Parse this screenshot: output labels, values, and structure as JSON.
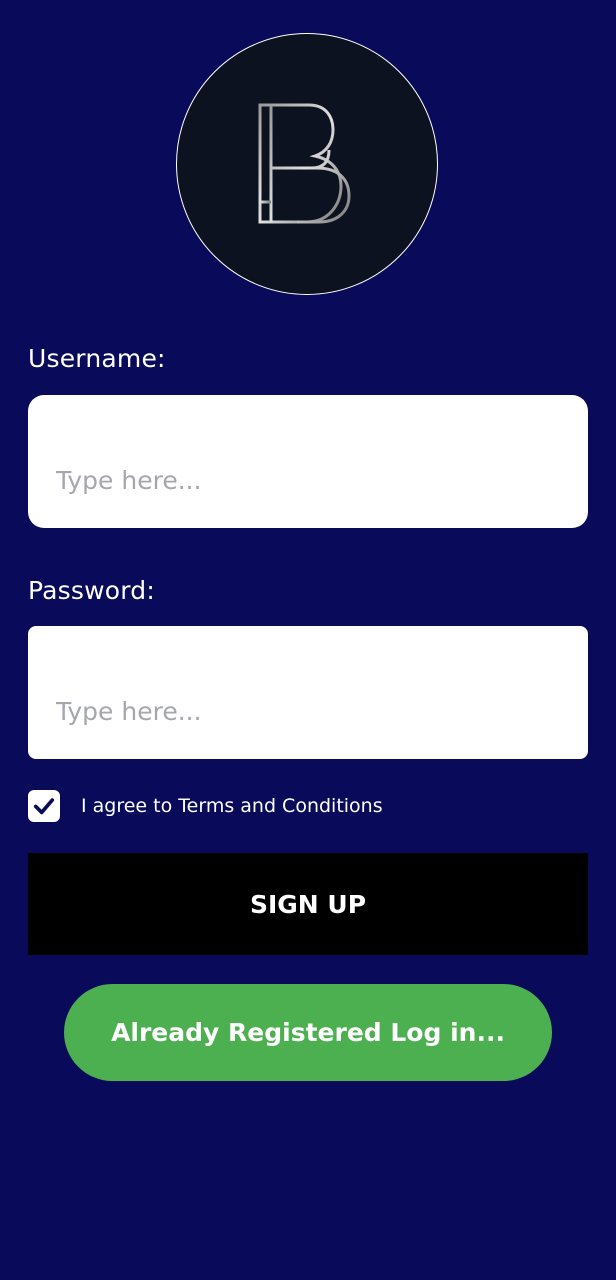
{
  "logo": {
    "icon": "bb-monogram-icon"
  },
  "form": {
    "username_label": "Username:",
    "username_placeholder": "Type here...",
    "username_value": "",
    "password_label": "Password:",
    "password_placeholder": "Type here...",
    "password_value": "",
    "agree_text": "I agree to Terms and Conditions",
    "agree_checked": true
  },
  "buttons": {
    "signup_label": "SIGN UP",
    "login_label": "Already Registered Log in..."
  },
  "colors": {
    "background": "#0a0a5a",
    "signup_button": "#000000",
    "login_button": "#4caf50",
    "input_background": "#ffffff"
  }
}
